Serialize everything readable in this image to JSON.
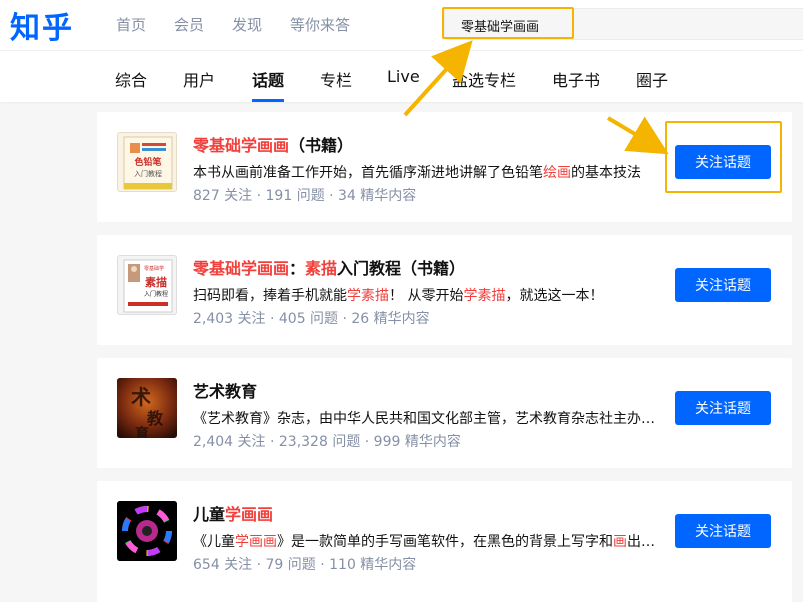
{
  "header": {
    "logo": "知乎",
    "nav": [
      "首页",
      "会员",
      "发现",
      "等你来答"
    ],
    "search_value": "零基础学画画"
  },
  "tabs": [
    "综合",
    "用户",
    "话题",
    "专栏",
    "Live",
    "盐选专栏",
    "电子书",
    "圈子"
  ],
  "active_tab": "话题",
  "results": [
    {
      "title_parts": [
        {
          "text": "零基础学画画",
          "hl": true
        },
        {
          "text": "（书籍）",
          "hl": false
        }
      ],
      "desc_parts": [
        {
          "text": "本书从画前准备工作开始，首先循序渐进地讲解了色铅笔",
          "hl": false
        },
        {
          "text": "绘画",
          "hl": true
        },
        {
          "text": "的基本技法",
          "hl": false
        }
      ],
      "meta": "827 关注 · 191 问题 · 34 精华内容",
      "thumb": "book-cover-colored-pencil",
      "thumb_text": "色铅笔\n入门教程",
      "button": "关注话题"
    },
    {
      "title_parts": [
        {
          "text": "零基础学画画",
          "hl": true
        },
        {
          "text": "：",
          "hl": false
        },
        {
          "text": "素描",
          "hl": true
        },
        {
          "text": "入门教程（书籍）",
          "hl": false
        }
      ],
      "desc_parts": [
        {
          "text": "扫码即看，捧着手机就能",
          "hl": false
        },
        {
          "text": "学素描",
          "hl": true
        },
        {
          "text": "！ 从零开始",
          "hl": false
        },
        {
          "text": "学素描",
          "hl": true
        },
        {
          "text": "，就选这一本！",
          "hl": false
        }
      ],
      "meta": "2,403 关注 · 405 问题 · 26 精华内容",
      "thumb": "book-cover-sketch",
      "thumb_text": "素描\n入门教程",
      "button": "关注话题"
    },
    {
      "title_parts": [
        {
          "text": "艺术教育",
          "hl": false
        }
      ],
      "desc_parts": [
        {
          "text": "《艺术教育》杂志，由中华人民共和国文化部主管，艺术教育杂志社主办…",
          "hl": false
        }
      ],
      "meta": "2,404 关注 · 23,328 问题 · 999 精华内容",
      "thumb": "magazine-cover-art-education",
      "thumb_text": "术教育",
      "button": "关注话题"
    },
    {
      "title_parts": [
        {
          "text": "儿童",
          "hl": false
        },
        {
          "text": "学画画",
          "hl": true
        }
      ],
      "desc_parts": [
        {
          "text": "《儿童",
          "hl": false
        },
        {
          "text": "学画画",
          "hl": true
        },
        {
          "text": "》是一款简单的手写画笔软件，在黑色的背景上写字和",
          "hl": false
        },
        {
          "text": "画",
          "hl": true
        },
        {
          "text": "出…",
          "hl": false
        }
      ],
      "meta": "654 关注 · 79 问题 · 110 精华内容",
      "thumb": "app-icon-color-wheel",
      "thumb_text": "",
      "button": "关注话题"
    }
  ],
  "colors": {
    "brand": "#0066ff",
    "highlight": "#f1403c",
    "annotation": "#f5b400"
  }
}
